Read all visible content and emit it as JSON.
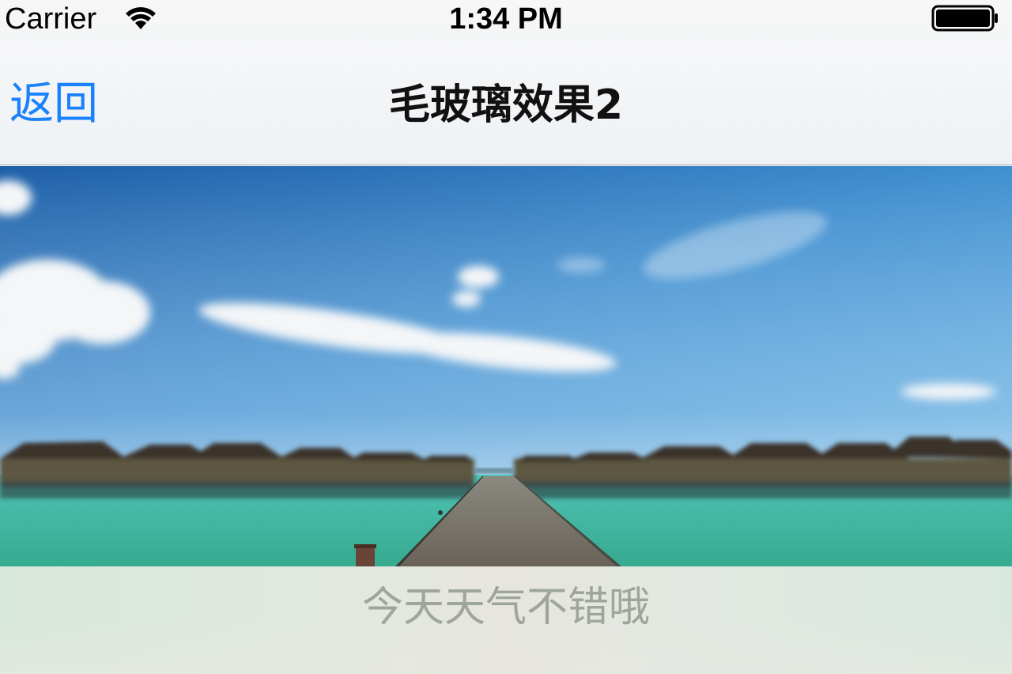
{
  "status_bar": {
    "carrier": "Carrier",
    "time": "1:34 PM",
    "wifi_icon": "wifi-icon",
    "battery_icon": "battery-full-icon"
  },
  "nav_bar": {
    "back_label": "返回",
    "title": "毛玻璃效果2",
    "accent_color": "#1a82fb"
  },
  "content": {
    "image_description_icon": "photo",
    "frosted_caption": "今天天气不错哦"
  }
}
